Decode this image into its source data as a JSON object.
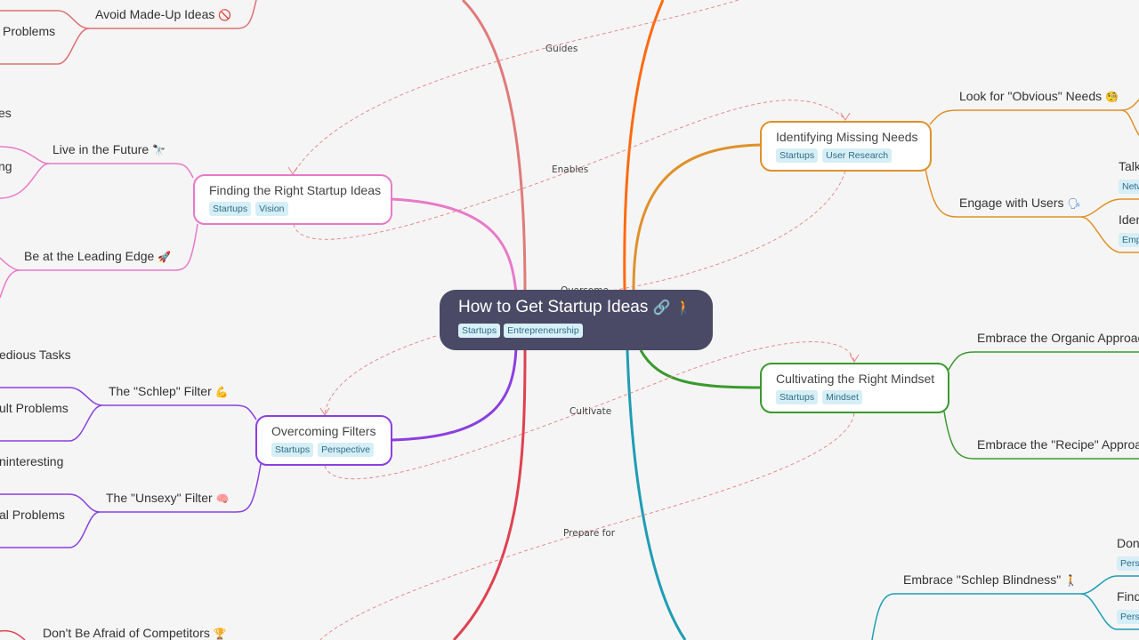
{
  "root": {
    "title": "How to Get Startup Ideas",
    "icons": [
      "link-icon",
      "walking-person-icon"
    ],
    "icon_glyphs": [
      "🔗",
      "🚶"
    ],
    "tags": [
      "Startups",
      "Entrepreneurship"
    ]
  },
  "branches": {
    "finding": {
      "title": "Finding the Right Startup Ideas",
      "tags": [
        "Startups",
        "Vision"
      ],
      "color": "#e879c9",
      "children": [
        {
          "label": "Live in the Future",
          "icon": "telescope-icon",
          "glyph": "🔭"
        },
        {
          "label": "Be at the Leading Edge",
          "icon": "rocket-icon",
          "glyph": "🚀"
        }
      ],
      "grandchildren_partial": [
        "es",
        "ng"
      ]
    },
    "filters": {
      "title": "Overcoming Filters",
      "tags": [
        "Startups",
        "Perspective"
      ],
      "color": "#8b3fe0",
      "children": [
        {
          "label": "The \"Schlep\" Filter",
          "icon": "flexed-biceps-icon",
          "glyph": "💪"
        },
        {
          "label": "The \"Unsexy\" Filter",
          "icon": "brain-icon",
          "glyph": "🧠"
        }
      ],
      "grandchildren_partial": [
        "edious Tasks",
        "ult Problems",
        "ninteresting",
        "al Problems"
      ]
    },
    "needs": {
      "title": "Identifying Missing Needs",
      "tags": [
        "Startups",
        "User Research"
      ],
      "color": "#e0912a",
      "children": [
        {
          "label": "Look for \"Obvious\" Needs",
          "icon": "face-with-monocle-icon",
          "glyph": "🧐"
        },
        {
          "label": "Engage with Users",
          "icon": "speaking-head-icon",
          "glyph": "🗣"
        }
      ],
      "grandchildren_partial": [
        {
          "label": "Talk",
          "tag": "Netw"
        },
        {
          "label": "Iden",
          "tag": "Emp"
        }
      ]
    },
    "mindset": {
      "title": "Cultivating the Right Mindset",
      "tags": [
        "Startups",
        "Mindset"
      ],
      "color": "#3a9a2e",
      "children": [
        {
          "label": "Embrace the Organic Approach"
        },
        {
          "label": "Embrace the \"Recipe\" Approac"
        }
      ]
    },
    "schlep": {
      "color": "#1f9cb5",
      "children": [
        {
          "label": "Embrace \"Schlep Blindness\"",
          "icon": "walking-person-icon",
          "glyph": "🚶"
        }
      ],
      "grandchildren_partial": [
        {
          "label": "Don",
          "tag": "Persi"
        },
        {
          "label": "Find",
          "tag": "Persp"
        }
      ]
    },
    "made_up": {
      "color": "#e07070",
      "children": [
        {
          "label": "Avoid Made-Up Ideas",
          "icon": "prohibited-icon",
          "glyph": "🚫"
        }
      ],
      "grandchildren_partial": [
        "Problems"
      ]
    },
    "competitors": {
      "color": "#e04050",
      "children": [
        {
          "label": "Don't Be Afraid of Competitors",
          "icon": "trophy-icon",
          "glyph": "🏆"
        }
      ]
    }
  },
  "relations": [
    {
      "label": "Guides"
    },
    {
      "label": "Enables"
    },
    {
      "label": "Overcome"
    },
    {
      "label": "Cultivate"
    },
    {
      "label": "Prepare for"
    }
  ],
  "colors": {
    "background": "#f5f5f5",
    "root_fill": "#4a4a66",
    "tag_bg": "#d6eef6",
    "tag_text": "#2f6e88",
    "relation_line": "#e88080",
    "orange_top": "#ff6a10"
  }
}
